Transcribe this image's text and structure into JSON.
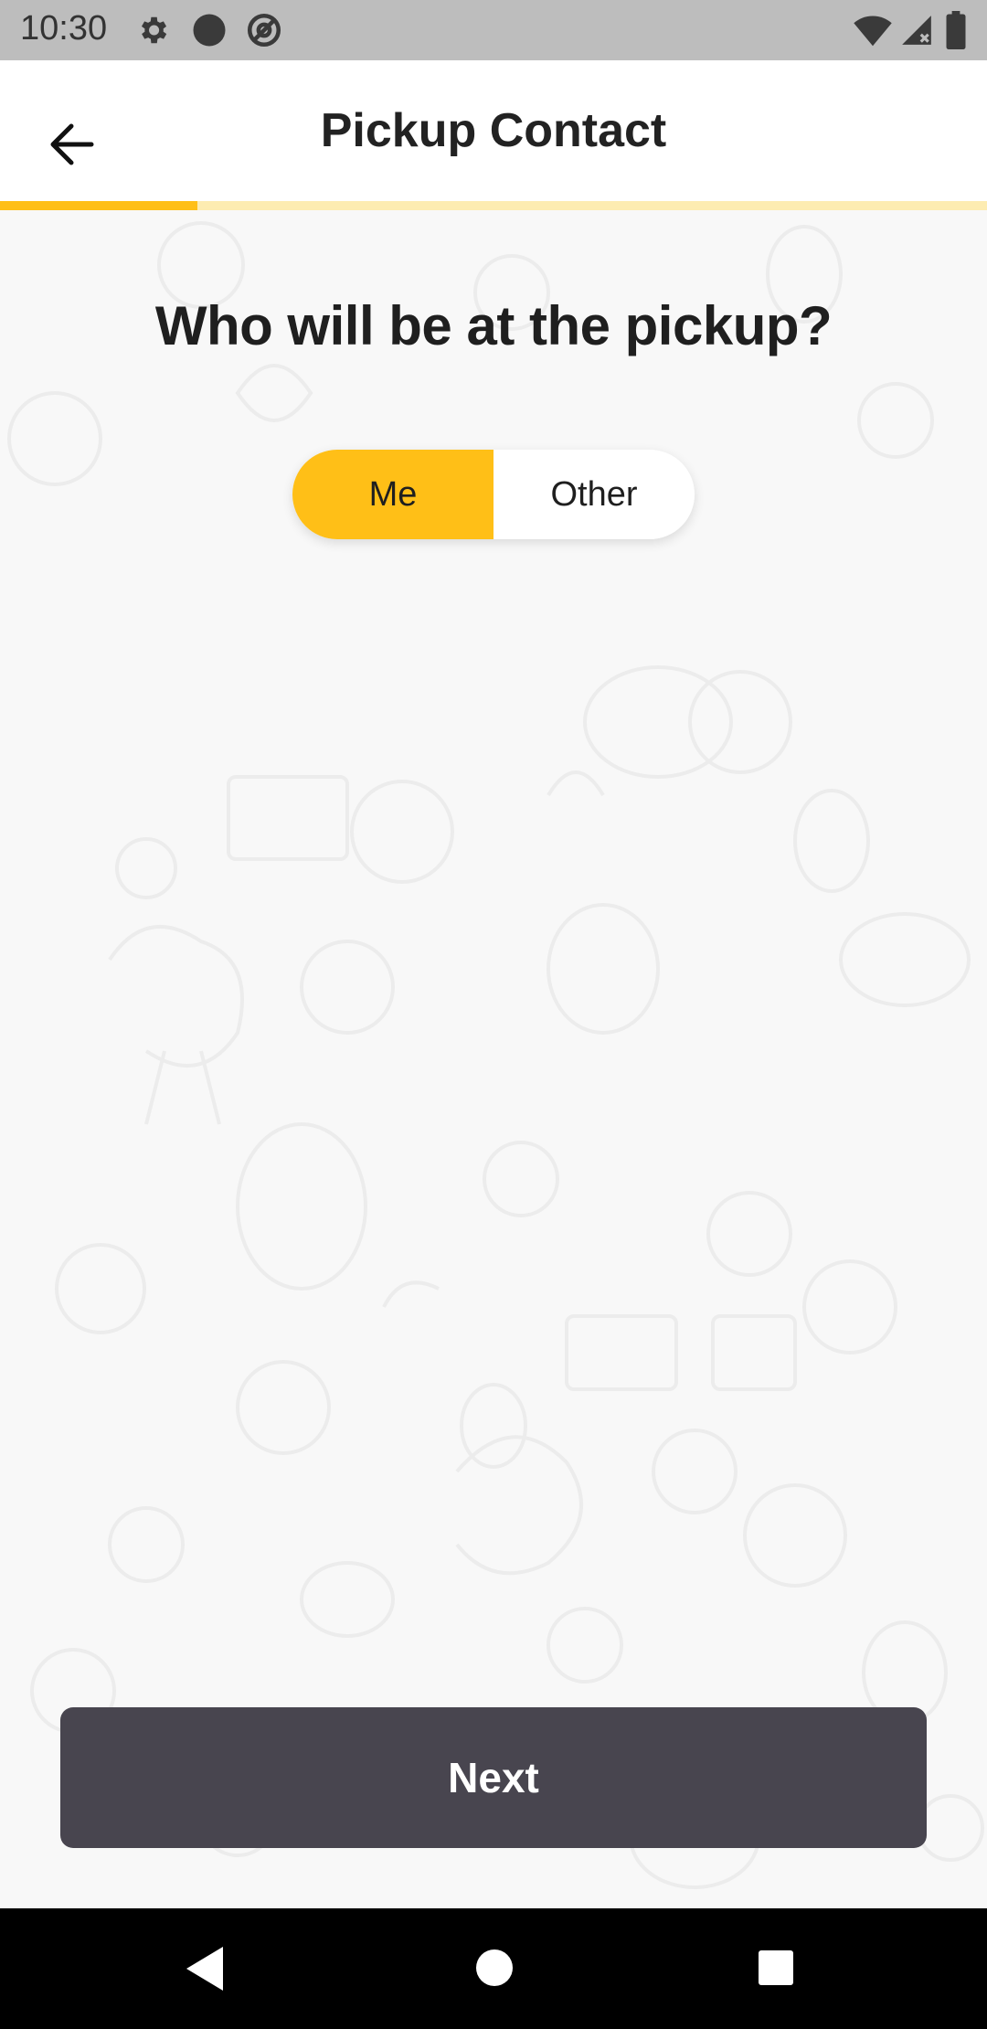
{
  "status_bar": {
    "time": "10:30",
    "icons": [
      "gear-icon",
      "circle-icon",
      "at-sign-icon",
      "wifi-icon",
      "signal-icon",
      "battery-icon"
    ]
  },
  "app_bar": {
    "title": "Pickup Contact",
    "back_icon": "arrow-left-icon"
  },
  "progress": {
    "value": 0.2,
    "fill_color": "#ffbf17",
    "track_color": "#fdecb1"
  },
  "main": {
    "question": "Who will be at the pickup?",
    "toggle": {
      "options": [
        "Me",
        "Other"
      ],
      "selected": "Me",
      "accent": "#ffbf17"
    },
    "next_label": "Next",
    "next_color": "#48454f"
  },
  "nav_bar": {
    "icons": [
      "back-triangle-icon",
      "home-circle-icon",
      "recents-square-icon"
    ]
  }
}
